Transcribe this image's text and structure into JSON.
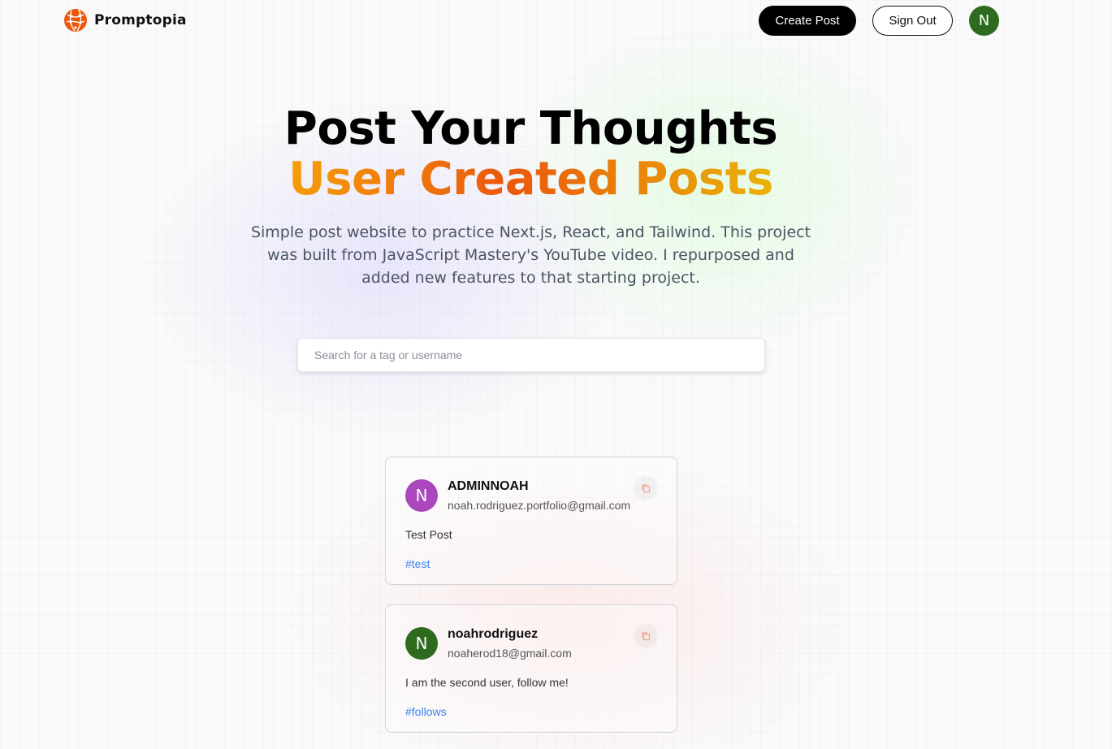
{
  "nav": {
    "brand": "Promptopia",
    "create_label": "Create Post",
    "signout_label": "Sign Out",
    "avatar_letter": "N",
    "avatar_color": "#2e6b1f",
    "logo_color": "#ea580c",
    "logo_icon": "globe-network-icon"
  },
  "hero": {
    "title_line1": "Post Your Thoughts",
    "title_line2": "User Created Posts",
    "description": "Simple post website to practice Next.js, React, and Tailwind. This project was built from JavaScript Mastery's YouTube video. I repurposed and added new features to that starting project."
  },
  "search": {
    "placeholder": "Search for a tag or username",
    "value": ""
  },
  "posts": [
    {
      "username": "ADMINNOAH",
      "email": "noah.rodriguez.portfolio@gmail.com",
      "avatar_letter": "N",
      "avatar_color": "#ab47bc",
      "text": "Test Post",
      "tag": "#test",
      "copy_icon": "copy-icon"
    },
    {
      "username": "noahrodriguez",
      "email": "noaherod18@gmail.com",
      "avatar_letter": "N",
      "avatar_color": "#2e6b1f",
      "text": "I am the second user, follow me!",
      "tag": "#follows",
      "copy_icon": "copy-icon"
    }
  ],
  "colors": {
    "tag_blue": "#3b82f6",
    "gradient_orange": "#ea580c",
    "gradient_amber": "#f59e0b"
  }
}
